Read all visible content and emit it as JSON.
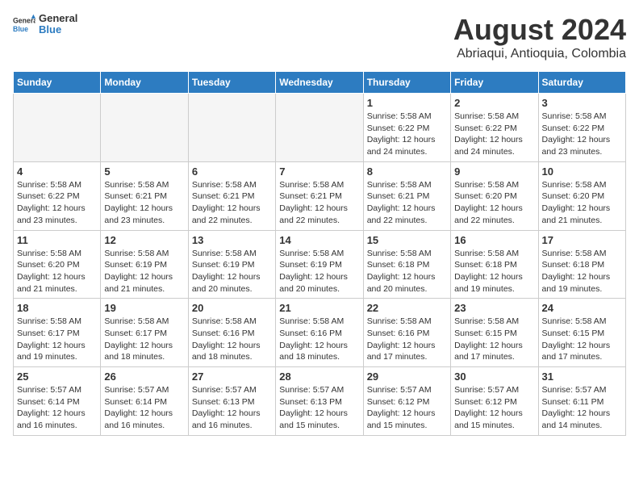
{
  "logo": {
    "line1": "General",
    "line2": "Blue"
  },
  "title": "August 2024",
  "subtitle": "Abriaqui, Antioquia, Colombia",
  "weekdays": [
    "Sunday",
    "Monday",
    "Tuesday",
    "Wednesday",
    "Thursday",
    "Friday",
    "Saturday"
  ],
  "weeks": [
    [
      {
        "day": "",
        "empty": true
      },
      {
        "day": "",
        "empty": true
      },
      {
        "day": "",
        "empty": true
      },
      {
        "day": "",
        "empty": true
      },
      {
        "day": "1",
        "sunrise": "5:58 AM",
        "sunset": "6:22 PM",
        "daylight": "12 hours and 24 minutes."
      },
      {
        "day": "2",
        "sunrise": "5:58 AM",
        "sunset": "6:22 PM",
        "daylight": "12 hours and 24 minutes."
      },
      {
        "day": "3",
        "sunrise": "5:58 AM",
        "sunset": "6:22 PM",
        "daylight": "12 hours and 23 minutes."
      }
    ],
    [
      {
        "day": "4",
        "sunrise": "5:58 AM",
        "sunset": "6:22 PM",
        "daylight": "12 hours and 23 minutes."
      },
      {
        "day": "5",
        "sunrise": "5:58 AM",
        "sunset": "6:21 PM",
        "daylight": "12 hours and 23 minutes."
      },
      {
        "day": "6",
        "sunrise": "5:58 AM",
        "sunset": "6:21 PM",
        "daylight": "12 hours and 22 minutes."
      },
      {
        "day": "7",
        "sunrise": "5:58 AM",
        "sunset": "6:21 PM",
        "daylight": "12 hours and 22 minutes."
      },
      {
        "day": "8",
        "sunrise": "5:58 AM",
        "sunset": "6:21 PM",
        "daylight": "12 hours and 22 minutes."
      },
      {
        "day": "9",
        "sunrise": "5:58 AM",
        "sunset": "6:20 PM",
        "daylight": "12 hours and 22 minutes."
      },
      {
        "day": "10",
        "sunrise": "5:58 AM",
        "sunset": "6:20 PM",
        "daylight": "12 hours and 21 minutes."
      }
    ],
    [
      {
        "day": "11",
        "sunrise": "5:58 AM",
        "sunset": "6:20 PM",
        "daylight": "12 hours and 21 minutes."
      },
      {
        "day": "12",
        "sunrise": "5:58 AM",
        "sunset": "6:19 PM",
        "daylight": "12 hours and 21 minutes."
      },
      {
        "day": "13",
        "sunrise": "5:58 AM",
        "sunset": "6:19 PM",
        "daylight": "12 hours and 20 minutes."
      },
      {
        "day": "14",
        "sunrise": "5:58 AM",
        "sunset": "6:19 PM",
        "daylight": "12 hours and 20 minutes."
      },
      {
        "day": "15",
        "sunrise": "5:58 AM",
        "sunset": "6:18 PM",
        "daylight": "12 hours and 20 minutes."
      },
      {
        "day": "16",
        "sunrise": "5:58 AM",
        "sunset": "6:18 PM",
        "daylight": "12 hours and 19 minutes."
      },
      {
        "day": "17",
        "sunrise": "5:58 AM",
        "sunset": "6:18 PM",
        "daylight": "12 hours and 19 minutes."
      }
    ],
    [
      {
        "day": "18",
        "sunrise": "5:58 AM",
        "sunset": "6:17 PM",
        "daylight": "12 hours and 19 minutes."
      },
      {
        "day": "19",
        "sunrise": "5:58 AM",
        "sunset": "6:17 PM",
        "daylight": "12 hours and 18 minutes."
      },
      {
        "day": "20",
        "sunrise": "5:58 AM",
        "sunset": "6:16 PM",
        "daylight": "12 hours and 18 minutes."
      },
      {
        "day": "21",
        "sunrise": "5:58 AM",
        "sunset": "6:16 PM",
        "daylight": "12 hours and 18 minutes."
      },
      {
        "day": "22",
        "sunrise": "5:58 AM",
        "sunset": "6:16 PM",
        "daylight": "12 hours and 17 minutes."
      },
      {
        "day": "23",
        "sunrise": "5:58 AM",
        "sunset": "6:15 PM",
        "daylight": "12 hours and 17 minutes."
      },
      {
        "day": "24",
        "sunrise": "5:58 AM",
        "sunset": "6:15 PM",
        "daylight": "12 hours and 17 minutes."
      }
    ],
    [
      {
        "day": "25",
        "sunrise": "5:57 AM",
        "sunset": "6:14 PM",
        "daylight": "12 hours and 16 minutes."
      },
      {
        "day": "26",
        "sunrise": "5:57 AM",
        "sunset": "6:14 PM",
        "daylight": "12 hours and 16 minutes."
      },
      {
        "day": "27",
        "sunrise": "5:57 AM",
        "sunset": "6:13 PM",
        "daylight": "12 hours and 16 minutes."
      },
      {
        "day": "28",
        "sunrise": "5:57 AM",
        "sunset": "6:13 PM",
        "daylight": "12 hours and 15 minutes."
      },
      {
        "day": "29",
        "sunrise": "5:57 AM",
        "sunset": "6:12 PM",
        "daylight": "12 hours and 15 minutes."
      },
      {
        "day": "30",
        "sunrise": "5:57 AM",
        "sunset": "6:12 PM",
        "daylight": "12 hours and 15 minutes."
      },
      {
        "day": "31",
        "sunrise": "5:57 AM",
        "sunset": "6:11 PM",
        "daylight": "12 hours and 14 minutes."
      }
    ]
  ],
  "labels": {
    "sunrise": "Sunrise:",
    "sunset": "Sunset:",
    "daylight": "Daylight:"
  }
}
